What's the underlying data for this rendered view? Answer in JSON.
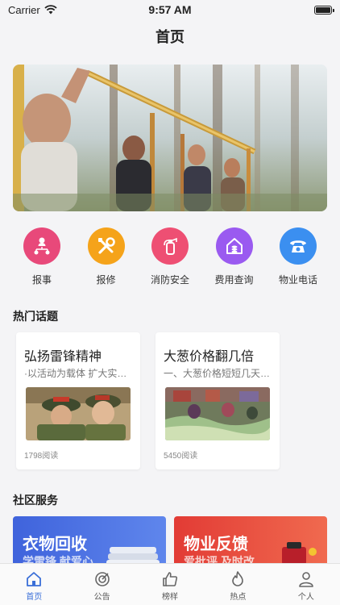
{
  "status_bar": {
    "carrier": "Carrier",
    "time": "9:57 AM"
  },
  "header": {
    "title": "首页"
  },
  "quick_actions": [
    {
      "label": "报事",
      "icon": "people-hierarchy-icon",
      "color": "#e8497a"
    },
    {
      "label": "报修",
      "icon": "tools-icon",
      "color": "#f5a31a"
    },
    {
      "label": "消防安全",
      "icon": "fire-extinguisher-icon",
      "color": "#ee4f73"
    },
    {
      "label": "费用查询",
      "icon": "house-coin-icon",
      "color": "#9a5af0"
    },
    {
      "label": "物业电话",
      "icon": "phone-icon",
      "color": "#3b8ff0"
    }
  ],
  "hot_topics": {
    "title": "热门话题",
    "items": [
      {
        "title": "弘扬雷锋精神",
        "excerpt": "·以活动为载体 扩大实…",
        "reads": "1798阅读"
      },
      {
        "title": "大葱价格翻几倍",
        "excerpt": "一、大葱价格短短几天…",
        "reads": "5450阅读"
      }
    ]
  },
  "community_services": {
    "title": "社区服务",
    "items": [
      {
        "title": "衣物回收",
        "subtitle": "学雷锋 献爱心",
        "color": "#4a6fe0"
      },
      {
        "title": "物业反馈",
        "subtitle": "爱批评 及时改",
        "color": "#e84a3c"
      }
    ]
  },
  "tab_bar": [
    {
      "label": "首页",
      "icon": "home-icon",
      "active": true
    },
    {
      "label": "公告",
      "icon": "target-icon",
      "active": false
    },
    {
      "label": "榜样",
      "icon": "thumbs-up-icon",
      "active": false
    },
    {
      "label": "热点",
      "icon": "flame-icon",
      "active": false
    },
    {
      "label": "个人",
      "icon": "user-icon",
      "active": false
    }
  ],
  "colors": {
    "accent": "#3a6fd8",
    "background": "#f4f4f6"
  }
}
